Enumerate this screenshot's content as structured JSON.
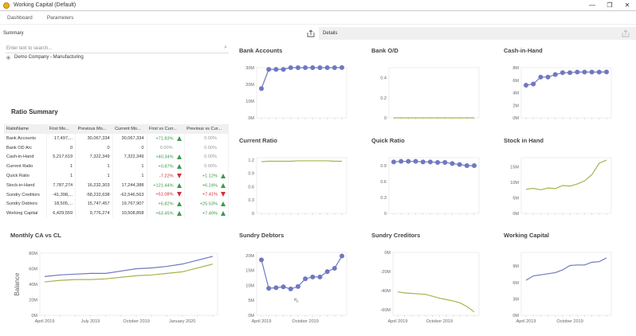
{
  "window": {
    "title": "Working Capital (Default)",
    "controls": [
      "—",
      "❐",
      "✕"
    ]
  },
  "tabs": [
    "Dashboard",
    "Parameters"
  ],
  "summary": {
    "header": "Summary",
    "search_placeholder": "Enter text to search...",
    "tree_item": "Demo Company - Manufacturing"
  },
  "details": {
    "header": "Details"
  },
  "ratio_summary": {
    "title": "Ratio Summary",
    "columns": [
      "RatioName",
      "First Mo...",
      "Previous Mo...",
      "Current Mo...",
      "First vs Curr...",
      "Previous vs Cur..."
    ],
    "rows": [
      {
        "name": "Bank Accounts",
        "first": "17,497,...",
        "prev": "30,067,334",
        "curr": "30,067,334",
        "fvc": "+71.83%",
        "fvc_trend": "up",
        "pvc": "0.00%",
        "pvc_trend": ""
      },
      {
        "name": "Bank OD A/c",
        "first": "0",
        "prev": "0",
        "curr": "0",
        "fvc": "0.00%",
        "fvc_trend": "",
        "pvc": "0.00%",
        "pvc_trend": ""
      },
      {
        "name": "Cash-in-Hand",
        "first": "5,217,619",
        "prev": "7,322,349",
        "curr": "7,322,349",
        "fvc": "+40.34%",
        "fvc_trend": "up",
        "pvc": "0.00%",
        "pvc_trend": ""
      },
      {
        "name": "Current Ratio",
        "first": "1",
        "prev": "1",
        "curr": "1",
        "fvc": "+0.87%",
        "fvc_trend": "up",
        "pvc": "0.00%",
        "pvc_trend": ""
      },
      {
        "name": "Quick Ratio",
        "first": "1",
        "prev": "1",
        "curr": "1",
        "fvc": "-7.22%",
        "fvc_trend": "down",
        "pvc": "+1.12%",
        "pvc_trend": "up"
      },
      {
        "name": "Stock-in-Hand",
        "first": "7,787,274",
        "prev": "16,232,303",
        "curr": "17,244,388",
        "fvc": "+121.44%",
        "fvc_trend": "up",
        "pvc": "+6.24%",
        "pvc_trend": "up"
      },
      {
        "name": "Sundry Creditors",
        "first": "-41,398,...",
        "prev": "-58,232,638",
        "curr": "-62,546,563",
        "fvc": "+51.08%",
        "fvc_trend": "down",
        "pvc": "+7.41%",
        "pvc_trend": "down"
      },
      {
        "name": "Sundry Debtors",
        "first": "18,505,...",
        "prev": "15,747,457",
        "curr": "19,767,907",
        "fvc": "+6.82%",
        "fvc_trend": "up",
        "pvc": "+25.53%",
        "pvc_trend": "up"
      },
      {
        "name": "Working Capital",
        "first": "6,429,559",
        "prev": "9,776,274",
        "curr": "10,508,858",
        "fvc": "+63.45%",
        "fvc_trend": "up",
        "pvc": "+7.49%",
        "pvc_trend": "up"
      }
    ]
  },
  "colors": {
    "blue": "#6f78c0",
    "green": "#a8b24c",
    "up": "#3a9a4a",
    "down": "#d0303a"
  },
  "chart_data": [
    {
      "id": "bank-accounts",
      "type": "line",
      "title": "Bank Accounts",
      "markers": true,
      "color": "#6f78c0",
      "yticks": [
        0,
        10,
        20,
        30
      ],
      "ytick_labels": [
        "0M",
        "10M",
        "20M",
        "30M"
      ],
      "ylim": [
        0,
        30
      ],
      "unit": "M",
      "series": [
        {
          "values": [
            17.5,
            29,
            29,
            29,
            30,
            30,
            30,
            30,
            30,
            30,
            30,
            30.07
          ]
        }
      ],
      "xtick_labels": []
    },
    {
      "id": "bank-od",
      "type": "line",
      "title": "Bank O/D",
      "markers": false,
      "color": "#a8b24c",
      "yticks": [
        0,
        0.2,
        0.4
      ],
      "ytick_labels": [
        "0",
        "0.2",
        "0.4"
      ],
      "ylim": [
        0,
        0.5
      ],
      "series": [
        {
          "values": [
            0,
            0,
            0,
            0,
            0,
            0,
            0,
            0,
            0,
            0,
            0,
            0
          ]
        }
      ],
      "xtick_labels": []
    },
    {
      "id": "cash-in-hand",
      "type": "line",
      "title": "Cash-in-Hand",
      "markers": true,
      "color": "#6f78c0",
      "yticks": [
        0,
        2,
        4,
        6,
        8
      ],
      "ytick_labels": [
        "0M",
        "2M",
        "4M",
        "6M",
        "8M"
      ],
      "ylim": [
        0,
        8
      ],
      "series": [
        {
          "values": [
            5.2,
            5.4,
            6.5,
            6.5,
            6.9,
            7.2,
            7.2,
            7.3,
            7.3,
            7.3,
            7.3,
            7.32
          ]
        }
      ],
      "xtick_labels": []
    },
    {
      "id": "current-ratio",
      "type": "line",
      "title": "Current Ratio",
      "markers": false,
      "color": "#a8b24c",
      "yticks": [
        0,
        0.3,
        0.6,
        0.9,
        1.2
      ],
      "ytick_labels": [
        "0",
        "0.3",
        "0.6",
        "0.9",
        "1.2"
      ],
      "ylim": [
        0,
        1.25
      ],
      "series": [
        {
          "values": [
            1.16,
            1.17,
            1.17,
            1.17,
            1.17,
            1.18,
            1.18,
            1.18,
            1.18,
            1.18,
            1.17,
            1.17
          ]
        }
      ],
      "xtick_labels": []
    },
    {
      "id": "quick-ratio",
      "type": "line",
      "title": "Quick Ratio",
      "markers": true,
      "color": "#6f78c0",
      "yticks": [
        0,
        0.3,
        0.6,
        0.9
      ],
      "ytick_labels": [
        "0",
        "0.3",
        "0.6",
        "0.9"
      ],
      "ylim": [
        0,
        1.05
      ],
      "series": [
        {
          "values": [
            0.97,
            0.98,
            0.98,
            0.98,
            0.97,
            0.97,
            0.96,
            0.96,
            0.94,
            0.92,
            0.9,
            0.9
          ]
        }
      ],
      "xtick_labels": []
    },
    {
      "id": "stock-in-hand",
      "type": "line",
      "title": "Stock in Hand",
      "markers": false,
      "color": "#a8b24c",
      "yticks": [
        0,
        5,
        10,
        15
      ],
      "ytick_labels": [
        "0M",
        "5M",
        "10M",
        "15M"
      ],
      "ylim": [
        0,
        18
      ],
      "series": [
        {
          "values": [
            7.8,
            8.1,
            7.6,
            8.2,
            8.0,
            9.0,
            8.8,
            9.5,
            10.5,
            12.5,
            16.2,
            17.2
          ]
        }
      ],
      "xtick_labels": []
    },
    {
      "id": "monthly-ca-vs-cl",
      "type": "line",
      "title": "Monthly CA vs CL",
      "ylabel": "Balance",
      "markers": false,
      "yticks": [
        0,
        20,
        40,
        60,
        80
      ],
      "ytick_labels": [
        "0M",
        "20M",
        "40M",
        "60M",
        "80M"
      ],
      "ylim": [
        0,
        80
      ],
      "series": [
        {
          "color": "#6f78c0",
          "values": [
            50,
            52,
            53,
            54,
            54,
            57,
            60,
            61,
            63,
            66,
            71,
            76
          ]
        },
        {
          "color": "#a8b24c",
          "values": [
            43,
            45,
            46,
            46,
            47,
            49,
            51,
            52,
            54,
            56,
            61,
            66
          ]
        }
      ],
      "xtick_labels": [
        {
          "i": 0,
          "label": "April 2019"
        },
        {
          "i": 3,
          "label": "July 2019"
        },
        {
          "i": 6,
          "label": "October 2019"
        },
        {
          "i": 9,
          "label": "January 2020"
        }
      ]
    },
    {
      "id": "sundry-debtors",
      "type": "line",
      "title": "Sundry Debtors",
      "markers": true,
      "color": "#6f78c0",
      "yticks": [
        0,
        5,
        10,
        15,
        20
      ],
      "ytick_labels": [
        "0M",
        "5M",
        "10M",
        "15M",
        "20M"
      ],
      "ylim": [
        0,
        21
      ],
      "series": [
        {
          "values": [
            18.5,
            9,
            9.2,
            9.5,
            8.8,
            9.6,
            12.2,
            12.8,
            12.8,
            14.6,
            15.7,
            19.8
          ]
        }
      ],
      "xtick_labels": [
        {
          "i": 0,
          "label": "April 2019"
        },
        {
          "i": 6,
          "label": "October 2019"
        }
      ]
    },
    {
      "id": "sundry-creditors",
      "type": "line",
      "title": "Sundry Creditors",
      "markers": false,
      "color": "#a8b24c",
      "yticks": [
        -60,
        -40,
        -20,
        0
      ],
      "ytick_labels": [
        "-60M",
        "-40M",
        "-20M",
        "0M"
      ],
      "ylim": [
        -66,
        0
      ],
      "series": [
        {
          "values": [
            -41.4,
            -42.5,
            -43,
            -43.5,
            -44,
            -46,
            -48,
            -49.5,
            -51,
            -53,
            -57,
            -62.5
          ]
        }
      ],
      "xtick_labels": [
        {
          "i": 0,
          "label": "April 2019"
        },
        {
          "i": 6,
          "label": "October 2019"
        }
      ]
    },
    {
      "id": "working-capital",
      "type": "line",
      "title": "Working Capital",
      "markers": false,
      "color": "#6f78c0",
      "yticks": [
        0,
        3,
        6,
        9
      ],
      "ytick_labels": [
        "0M",
        "3M",
        "6M",
        "9M"
      ],
      "ylim": [
        0,
        11.5
      ],
      "series": [
        {
          "values": [
            6.4,
            7.2,
            7.4,
            7.6,
            7.8,
            8.3,
            9.1,
            9.2,
            9.2,
            9.7,
            9.8,
            10.5
          ]
        }
      ],
      "xtick_labels": [
        {
          "i": 0,
          "label": "April 2019"
        },
        {
          "i": 6,
          "label": "October 2019"
        }
      ]
    }
  ]
}
